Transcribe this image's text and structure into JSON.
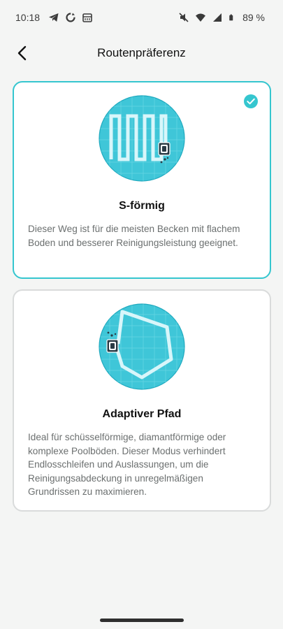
{
  "status_bar": {
    "time": "10:18",
    "battery": "89 %",
    "icons_left": [
      "telegram-icon",
      "sync-icon",
      "storage-icon"
    ],
    "icons_right": [
      "mute-icon",
      "wifi-icon",
      "signal-icon",
      "battery-icon"
    ]
  },
  "header": {
    "title": "Routenpräferenz",
    "back_icon": "chevron-left-icon"
  },
  "options": [
    {
      "title": "S-förmig",
      "description": "Dieser Weg ist für die meisten Becken mit flachem Boden und besserer Reinigungsleistung geeignet.",
      "selected": true
    },
    {
      "title": "Adaptiver Pfad",
      "description": "Ideal für schüsselförmige, diamantförmige oder komplexe Poolböden. Dieser Modus verhindert Endlosschleifen und Auslassungen, um die Reinigungsabdeckung in unregelmäßigen Grundrissen zu maximieren.",
      "selected": false
    }
  ],
  "colors": {
    "accent": "#35c6cf",
    "background": "#f4f5f4",
    "card": "#ffffff",
    "border": "#d9dbdb"
  }
}
